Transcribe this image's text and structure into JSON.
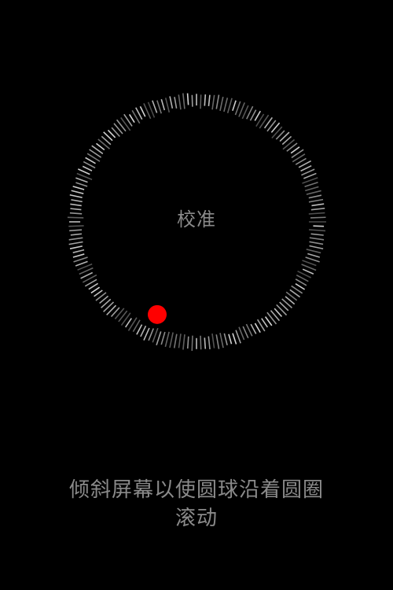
{
  "screen": {
    "title": "校准",
    "instruction": "倾斜屏幕以使圆球沿着圆圈滚动"
  },
  "dial": {
    "tick_color": "#d8d8d8",
    "ball_color": "#ff0000",
    "ball_angle_deg": 113
  },
  "background_color": "#000000"
}
